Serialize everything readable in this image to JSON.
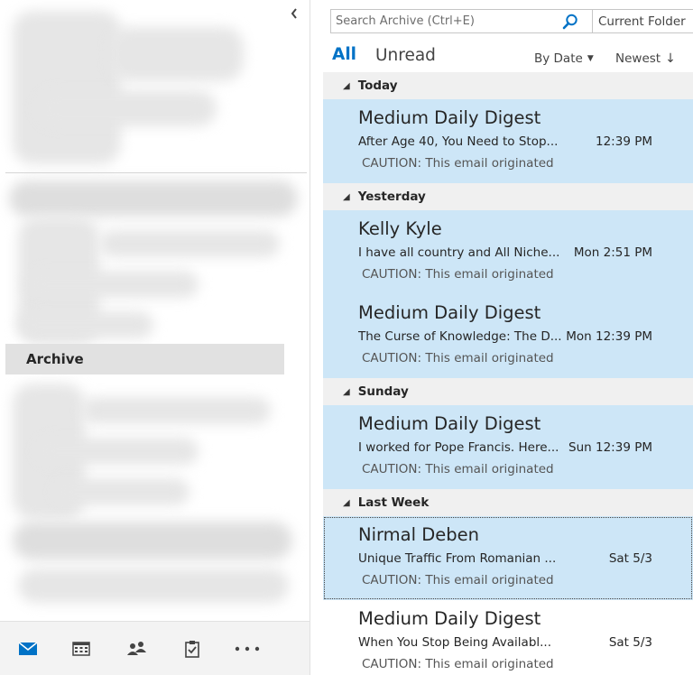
{
  "folder_pane": {
    "selected_folder": "Archive"
  },
  "nav_bar": {
    "items": [
      {
        "icon": "mail-icon",
        "color": "#0072c6"
      },
      {
        "icon": "calendar-icon",
        "color": "#444444"
      },
      {
        "icon": "people-icon",
        "color": "#444444"
      },
      {
        "icon": "tasks-icon",
        "color": "#444444"
      },
      {
        "icon": "more-icon",
        "color": "#444444"
      }
    ]
  },
  "search": {
    "placeholder": "Search Archive (Ctrl+E)",
    "scope": "Current Folder"
  },
  "filters": {
    "all": "All",
    "unread": "Unread",
    "sort_by": "By Date",
    "sort_order": "Newest"
  },
  "colors": {
    "accent": "#0072c6",
    "selected_row": "#cde6f7",
    "group_header": "#f0f0f0",
    "selected_folder": "#e1e1e1"
  },
  "groups": [
    {
      "label": "Today",
      "messages": [
        {
          "sender": "Medium Daily Digest",
          "subject": "After Age 40, You Need to Stop...",
          "time": "12:39 PM",
          "preview": "CAUTION: This email originated"
        }
      ]
    },
    {
      "label": "Yesterday",
      "messages": [
        {
          "sender": "Kelly Kyle",
          "subject": "I have all country and All Niche...",
          "time": "Mon 2:51 PM",
          "preview": "CAUTION: This email originated"
        },
        {
          "sender": "Medium Daily Digest",
          "subject": "The Curse of Knowledge: The D...",
          "time": "Mon 12:39 PM",
          "preview": "CAUTION: This email originated"
        }
      ]
    },
    {
      "label": "Sunday",
      "messages": [
        {
          "sender": "Medium Daily Digest",
          "subject": "I worked for Pope Francis. Here...",
          "time": "Sun 12:39 PM",
          "preview": "CAUTION: This email originated"
        }
      ]
    },
    {
      "label": "Last Week",
      "messages": [
        {
          "sender": "Nirmal Deben",
          "subject": "Unique Traffic From Romanian ...",
          "time": "Sat 5/3",
          "preview": "CAUTION: This email originated"
        },
        {
          "sender": "Medium Daily Digest",
          "subject": "When You Stop Being Availabl...",
          "time": "Sat 5/3",
          "preview": "CAUTION: This email originated"
        }
      ]
    }
  ]
}
